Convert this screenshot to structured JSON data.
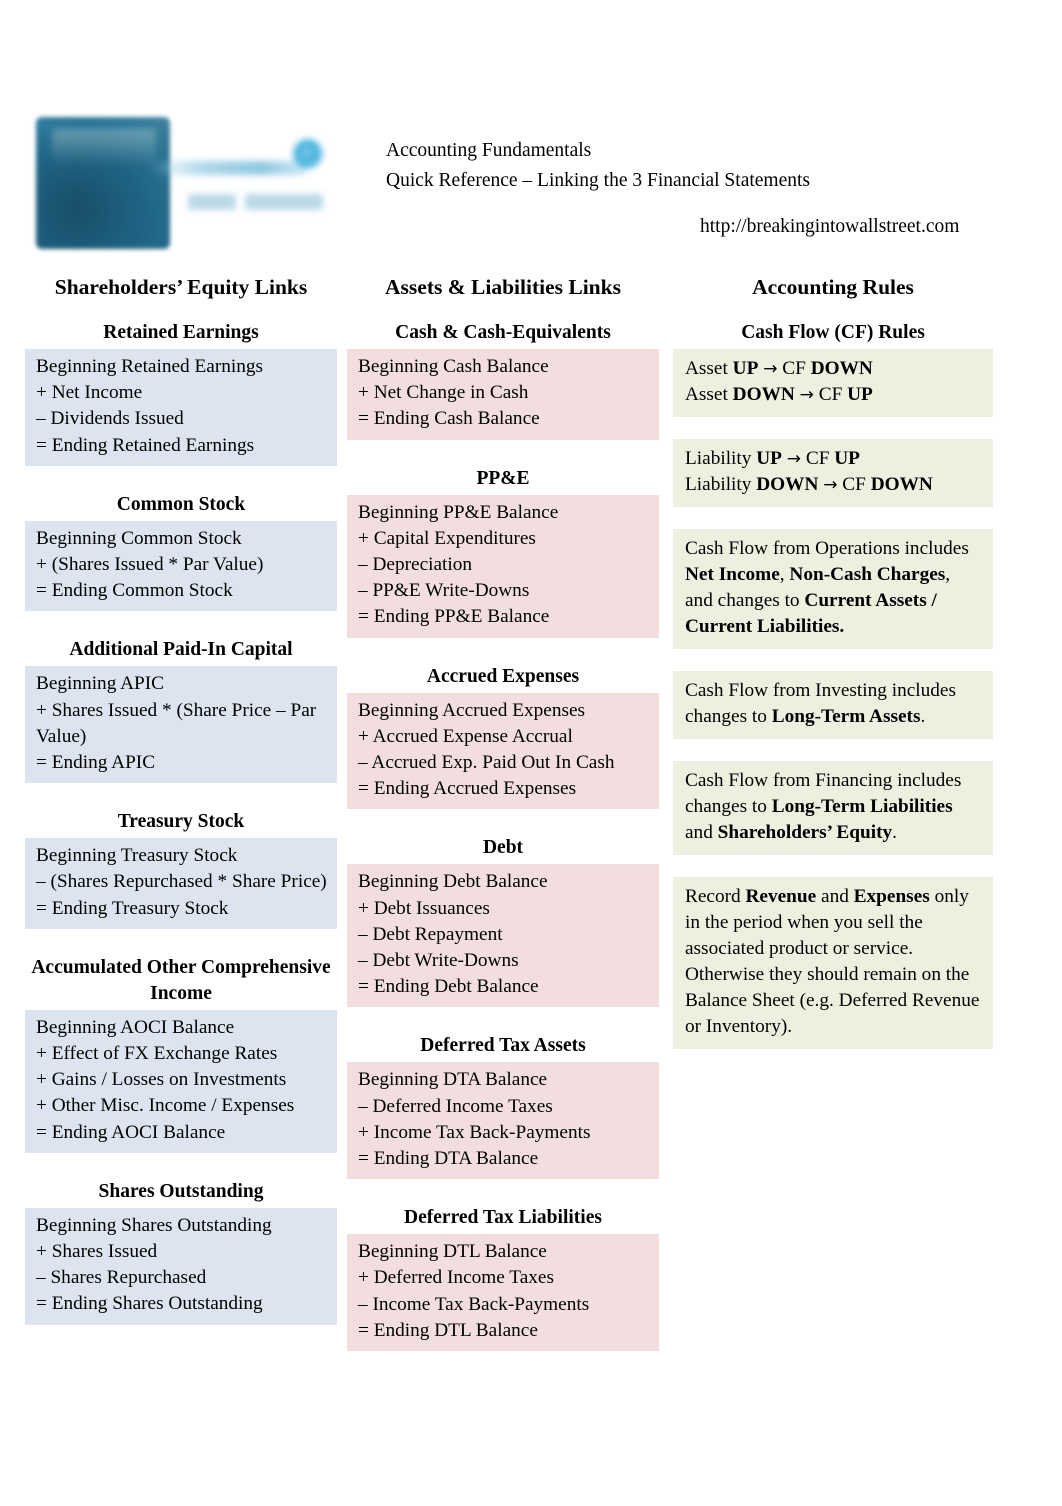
{
  "header": {
    "title_line_1": "Accounting Fundamentals",
    "title_line_2": "Quick Reference – Linking the 3 Financial Statements",
    "url": "http://breakingintowallstreet.com",
    "logo_alt": "breaking-into-wall-street-logo"
  },
  "colors": {
    "equity_block": "#dce5ef",
    "assets_block": "#f2dede",
    "rules_block": "#ecf1df",
    "text": "#000000",
    "page_background": "#ffffff"
  },
  "columns": [
    {
      "heading": "Shareholders’ Equity Links",
      "sections": [
        {
          "title": "Retained Earnings",
          "lines": [
            "Beginning Retained Earnings",
            "+ Net Income",
            "– Dividends Issued",
            "= Ending Retained Earnings"
          ]
        },
        {
          "title": "Common Stock",
          "lines": [
            "Beginning Common Stock",
            "+ (Shares Issued * Par Value)",
            "= Ending Common Stock"
          ]
        },
        {
          "title": "Additional Paid-In Capital",
          "lines": [
            "Beginning APIC",
            "+ Shares Issued * (Share Price – Par Value)",
            "= Ending APIC"
          ]
        },
        {
          "title": "Treasury Stock",
          "lines": [
            "Beginning Treasury Stock",
            "– (Shares Repurchased * Share Price)",
            "= Ending Treasury Stock"
          ]
        },
        {
          "title": "Accumulated Other Comprehensive Income",
          "lines": [
            "Beginning AOCI Balance",
            "+ Effect of FX Exchange Rates",
            "+ Gains / Losses on Investments",
            "+ Other Misc. Income / Expenses",
            "= Ending AOCI Balance"
          ]
        },
        {
          "title": "Shares Outstanding",
          "lines": [
            "Beginning Shares Outstanding",
            "+ Shares Issued",
            "– Shares Repurchased",
            "= Ending Shares Outstanding"
          ]
        }
      ]
    },
    {
      "heading": "Assets & Liabilities Links",
      "sections": [
        {
          "title": "Cash & Cash-Equivalents",
          "lines": [
            "Beginning Cash Balance",
            "+ Net Change in Cash",
            "= Ending Cash Balance"
          ]
        },
        {
          "title": "PP&E",
          "lines": [
            "Beginning PP&E Balance",
            "+ Capital Expenditures",
            "– Depreciation",
            "– PP&E Write-Downs",
            "= Ending PP&E Balance"
          ]
        },
        {
          "title": "Accrued Expenses",
          "lines": [
            "Beginning Accrued Expenses",
            "+ Accrued Expense Accrual",
            "– Accrued Exp. Paid Out In Cash",
            "= Ending Accrued Expenses"
          ]
        },
        {
          "title": "Debt",
          "lines": [
            "Beginning Debt Balance",
            "+ Debt Issuances",
            "– Debt Repayment",
            "– Debt Write-Downs",
            "= Ending Debt Balance"
          ]
        },
        {
          "title": "Deferred Tax Assets",
          "lines": [
            "Beginning DTA Balance",
            "– Deferred Income Taxes",
            "+ Income Tax Back-Payments",
            "= Ending DTA Balance"
          ]
        },
        {
          "title": "Deferred Tax Liabilities",
          "lines": [
            "Beginning DTL Balance",
            "+ Deferred Income Taxes",
            "– Income Tax Back-Payments",
            "= Ending DTL Balance"
          ]
        }
      ]
    }
  ],
  "rules": {
    "heading": "Accounting Rules",
    "section_title": "Cash Flow (CF) Rules",
    "blocks": [
      {
        "name": "asset-cf-rule",
        "lines_html": [
          "Asset <b>UP</b> <span class=\"arrow\">→</span> CF <b>DOWN</b>",
          "Asset <b>DOWN</b> <span class=\"arrow\">→</span> CF <b>UP</b>"
        ]
      },
      {
        "name": "liability-cf-rule",
        "lines_html": [
          "Liability <b>UP</b> <span class=\"arrow\">→</span> CF <b>UP</b>",
          "Liability <b>DOWN</b> <span class=\"arrow\">→</span> CF <b>DOWN</b>"
        ]
      },
      {
        "name": "cash-flow-operations-rule",
        "lines_html": [
          "Cash Flow from Operations includes <b>Net Income</b>, <b>Non-Cash Charges</b>, and changes to <b>Current Assets / Current Liabilities.</b>"
        ]
      },
      {
        "name": "cash-flow-investing-rule",
        "lines_html": [
          "Cash Flow from Investing includes changes to <b>Long-Term Assets</b>."
        ]
      },
      {
        "name": "cash-flow-financing-rule",
        "lines_html": [
          "Cash Flow from Financing includes changes to <b>Long-Term Liabilities</b> and <b>Shareholders’ Equity</b>."
        ]
      },
      {
        "name": "revenue-recognition-rule",
        "lines_html": [
          "Record <b>Revenue</b> and <b>Expenses</b> only in the period when you sell the associated product or service. Otherwise they should remain on the Balance Sheet (e.g. Deferred Revenue or Inventory)."
        ]
      }
    ]
  }
}
